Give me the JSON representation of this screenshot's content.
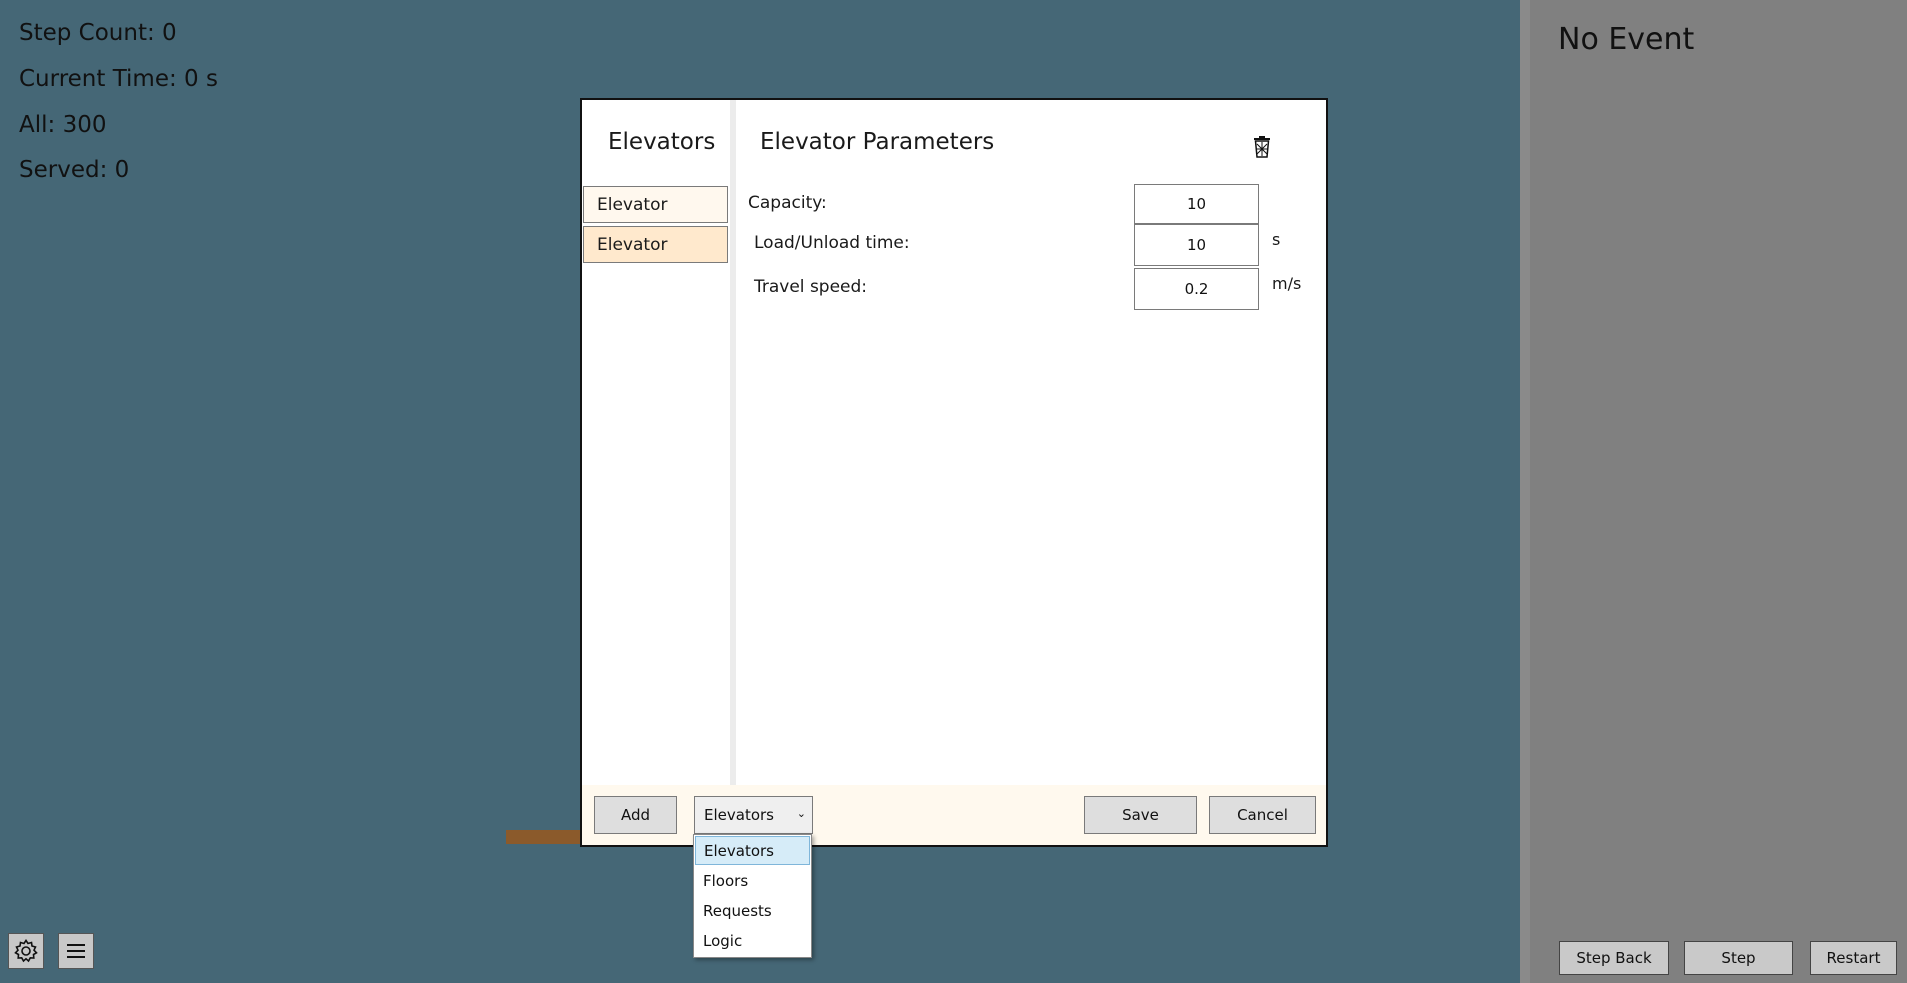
{
  "stats": {
    "step_count": "Step Count: 0",
    "current_time": "Current Time: 0 s",
    "all": "All: 300",
    "served": "Served: 0"
  },
  "event_panel": {
    "title": "No Event",
    "step_back": "Step Back",
    "step": "Step",
    "restart": "Restart"
  },
  "toolbar_icons": {
    "settings": "gear-icon",
    "menu": "menu-icon"
  },
  "dialog": {
    "sidebar_title": "Elevators",
    "elevators": [
      "Elevator",
      "Elevator"
    ],
    "selected_index": 1,
    "params_title": "Elevator Parameters",
    "delete_icon": "trash-icon",
    "capacity": {
      "label": "Capacity:",
      "value": "10"
    },
    "load_unload": {
      "label": "Load/Unload time:",
      "value": "10",
      "unit": "s"
    },
    "travel_speed": {
      "label": "Travel speed:",
      "value": "0.2",
      "unit": "m/s"
    },
    "footer": {
      "add": "Add",
      "mode_selected": "Elevators",
      "save": "Save",
      "cancel": "Cancel"
    }
  },
  "dropdown": {
    "options": [
      "Elevators",
      "Floors",
      "Requests",
      "Logic"
    ],
    "highlighted": "Elevators"
  },
  "colors": {
    "main_background": "#456776",
    "event_panel": "#808080",
    "selected_elevator": "#ffe9cd",
    "dropdown_highlight": "#d6ecf8"
  }
}
